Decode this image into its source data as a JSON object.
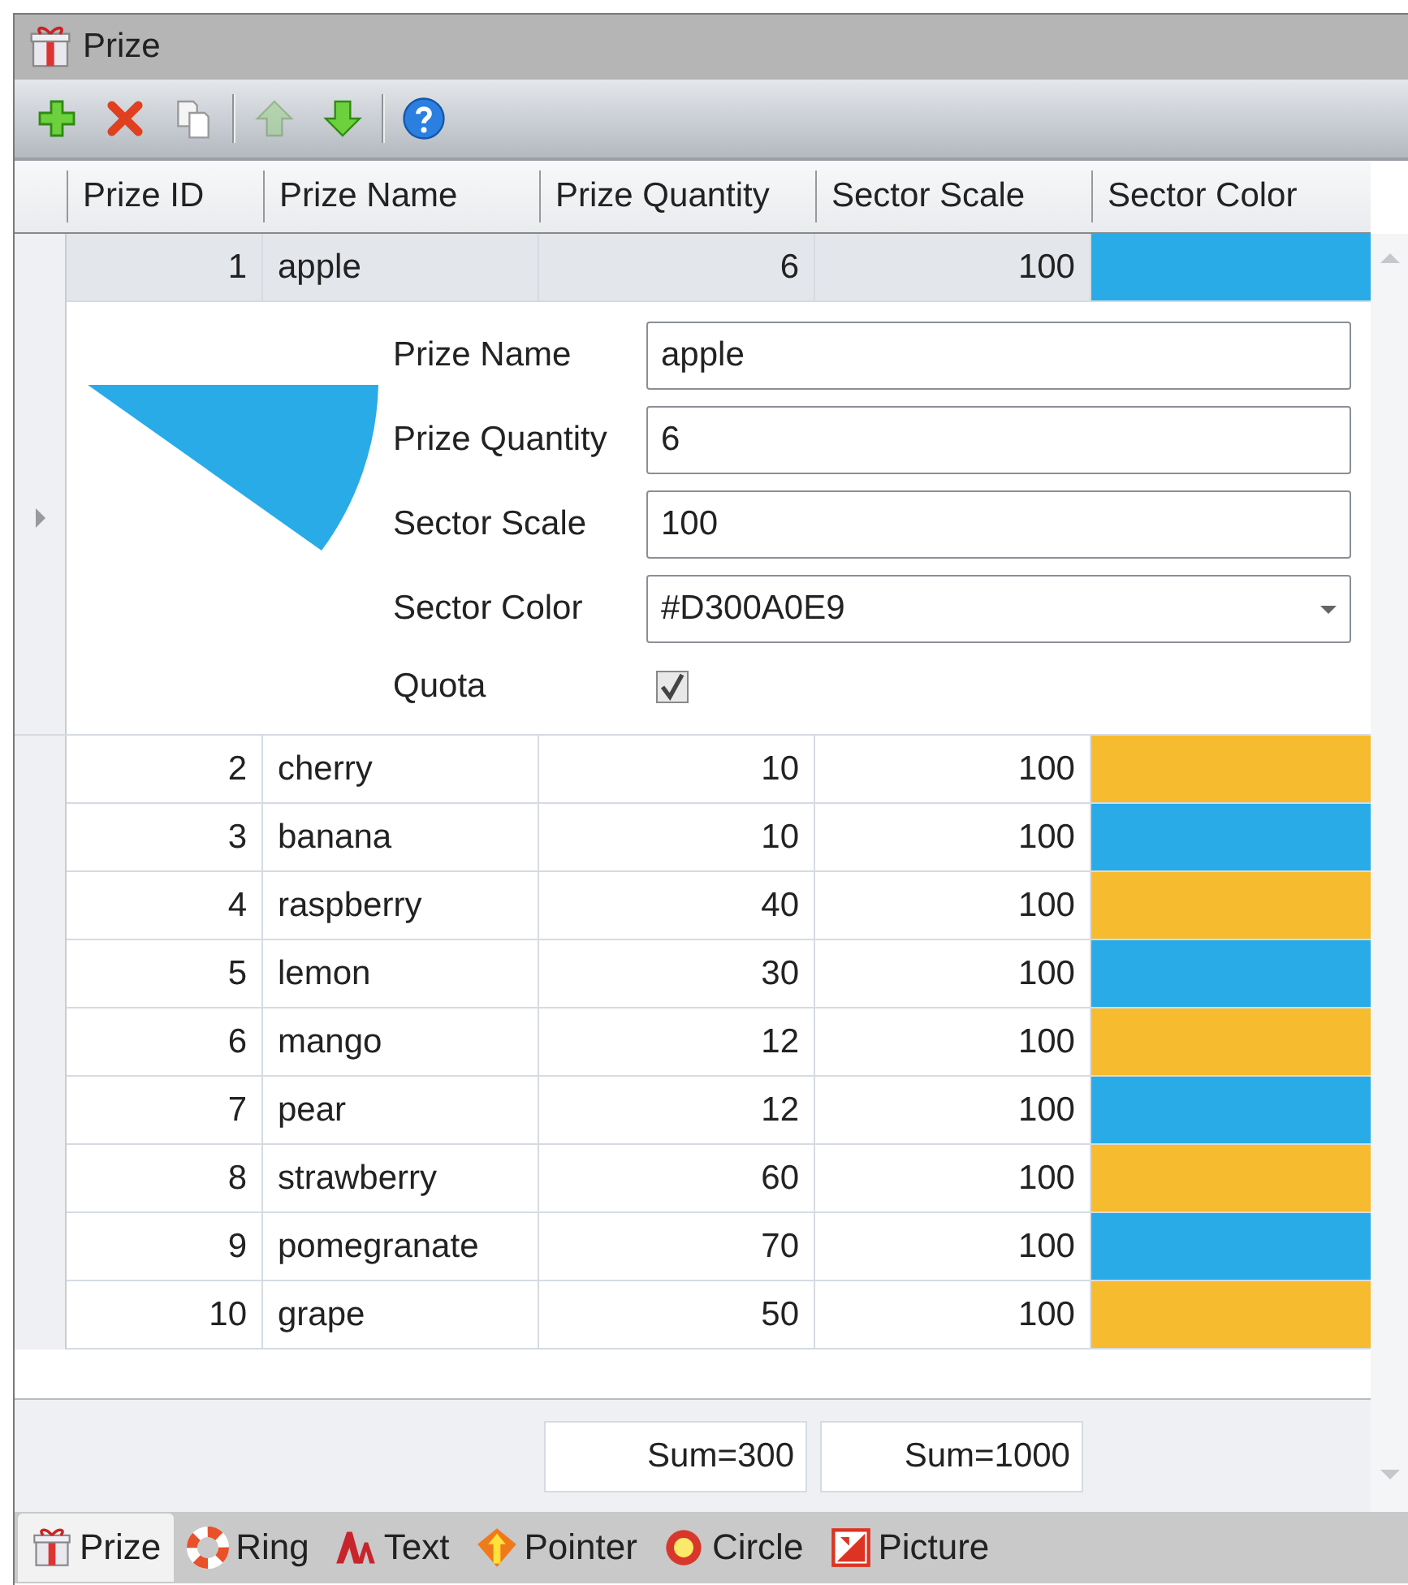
{
  "window": {
    "title": "Prize"
  },
  "toolbar": [
    {
      "kind": "add",
      "disabled": false
    },
    {
      "kind": "delete",
      "disabled": false
    },
    {
      "kind": "copy",
      "disabled": false
    },
    {
      "kind": "up",
      "disabled": true
    },
    {
      "kind": "down",
      "disabled": false
    },
    {
      "kind": "help",
      "disabled": false
    }
  ],
  "table": {
    "columns": [
      "Prize ID",
      "Prize Name",
      "Prize Quantity",
      "Sector Scale",
      "Sector Color"
    ],
    "rows": [
      {
        "id": "1",
        "name": "apple",
        "quantity": "6",
        "scale": "100",
        "color": "#29abe8",
        "selected": true,
        "detail": {
          "fields": [
            {
              "kind": "text",
              "label": "Prize Name",
              "value": "apple"
            },
            {
              "kind": "text",
              "label": "Prize Quantity",
              "value": "6"
            },
            {
              "kind": "text",
              "label": "Sector Scale",
              "value": "100"
            },
            {
              "kind": "dropdown",
              "label": "Sector Color",
              "value": "#D300A0E9"
            },
            {
              "kind": "checkbox",
              "label": "Quota",
              "checked": true
            }
          ]
        }
      },
      {
        "id": "2",
        "name": "cherry",
        "quantity": "10",
        "scale": "100",
        "color": "#f6bb2e",
        "selected": false
      },
      {
        "id": "3",
        "name": "banana",
        "quantity": "10",
        "scale": "100",
        "color": "#29abe8",
        "selected": false
      },
      {
        "id": "4",
        "name": "raspberry",
        "quantity": "40",
        "scale": "100",
        "color": "#f6bb2e",
        "selected": false
      },
      {
        "id": "5",
        "name": "lemon",
        "quantity": "30",
        "scale": "100",
        "color": "#29abe8",
        "selected": false
      },
      {
        "id": "6",
        "name": "mango",
        "quantity": "12",
        "scale": "100",
        "color": "#f6bb2e",
        "selected": false
      },
      {
        "id": "7",
        "name": "pear",
        "quantity": "12",
        "scale": "100",
        "color": "#29abe8",
        "selected": false
      },
      {
        "id": "8",
        "name": "strawberry",
        "quantity": "60",
        "scale": "100",
        "color": "#f6bb2e",
        "selected": false
      },
      {
        "id": "9",
        "name": "pomegranate",
        "quantity": "70",
        "scale": "100",
        "color": "#29abe8",
        "selected": false
      },
      {
        "id": "10",
        "name": "grape",
        "quantity": "50",
        "scale": "100",
        "color": "#f6bb2e",
        "selected": false
      }
    ]
  },
  "footer": {
    "sums": [
      "Sum=300",
      "Sum=1000"
    ]
  },
  "tabs": [
    {
      "kind": "gift",
      "label": "Prize",
      "selected": true
    },
    {
      "kind": "ring",
      "label": "Ring",
      "selected": false
    },
    {
      "kind": "text",
      "label": "Text",
      "selected": false
    },
    {
      "kind": "pointer",
      "label": "Pointer",
      "selected": false
    },
    {
      "kind": "circle",
      "label": "Circle",
      "selected": false
    },
    {
      "kind": "picture",
      "label": "Picture",
      "selected": false
    }
  ]
}
